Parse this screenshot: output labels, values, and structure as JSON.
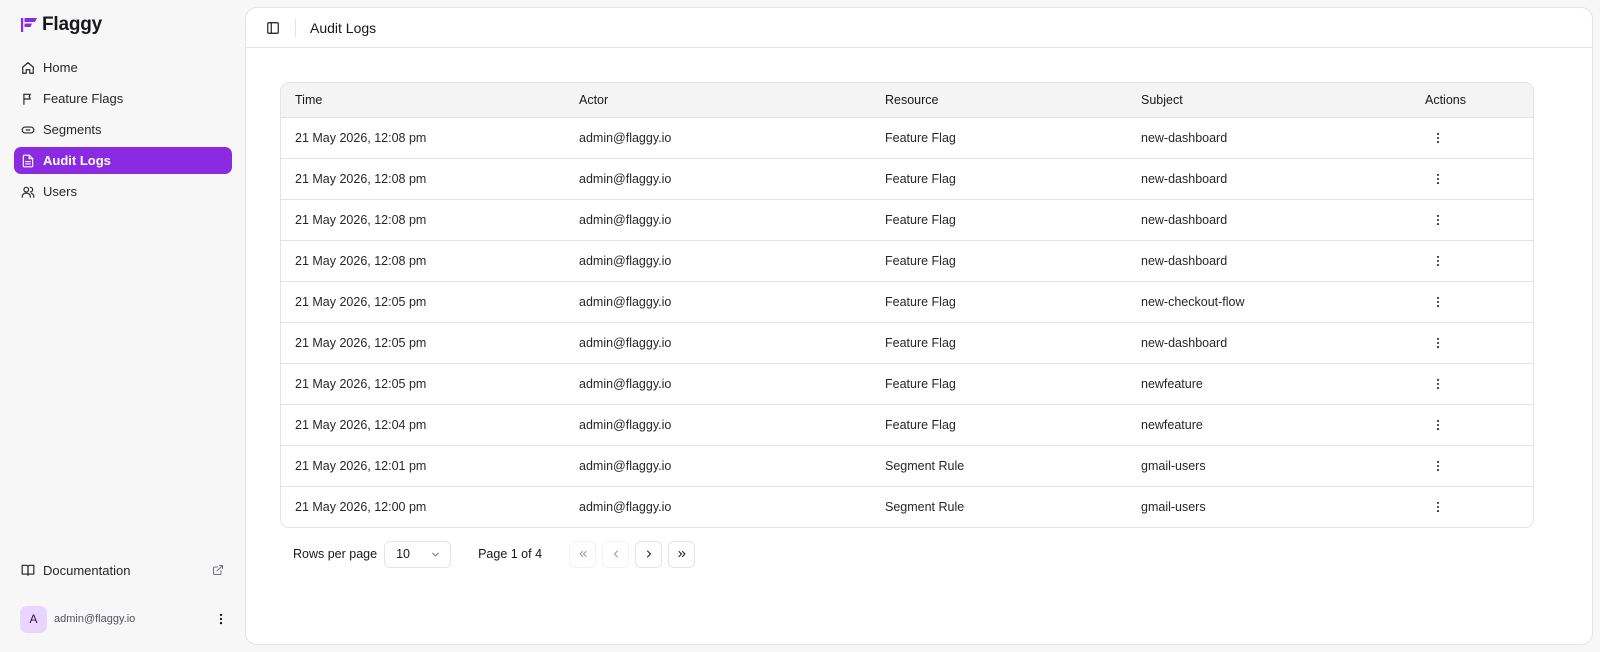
{
  "app": {
    "name": "Flaggy",
    "brand_color": "#8a2be2"
  },
  "sidebar": {
    "items": [
      {
        "label": "Home",
        "icon": "home-icon"
      },
      {
        "label": "Feature Flags",
        "icon": "flag-icon"
      },
      {
        "label": "Segments",
        "icon": "link-icon"
      },
      {
        "label": "Audit Logs",
        "icon": "file-text-icon",
        "active": true
      },
      {
        "label": "Users",
        "icon": "users-icon"
      }
    ],
    "documentation": {
      "label": "Documentation",
      "icon": "book-open-icon"
    },
    "user": {
      "initial": "A",
      "email": "admin@flaggy.io"
    }
  },
  "header": {
    "title": "Audit Logs"
  },
  "table": {
    "columns": [
      "Time",
      "Actor",
      "Resource",
      "Subject",
      "Actions"
    ],
    "rows": [
      [
        "21 May 2026, 12:08 pm",
        "admin@flaggy.io",
        "Feature Flag",
        "new-dashboard"
      ],
      [
        "21 May 2026, 12:08 pm",
        "admin@flaggy.io",
        "Feature Flag",
        "new-dashboard"
      ],
      [
        "21 May 2026, 12:08 pm",
        "admin@flaggy.io",
        "Feature Flag",
        "new-dashboard"
      ],
      [
        "21 May 2026, 12:08 pm",
        "admin@flaggy.io",
        "Feature Flag",
        "new-dashboard"
      ],
      [
        "21 May 2026, 12:05 pm",
        "admin@flaggy.io",
        "Feature Flag",
        "new-checkout-flow"
      ],
      [
        "21 May 2026, 12:05 pm",
        "admin@flaggy.io",
        "Feature Flag",
        "new-dashboard"
      ],
      [
        "21 May 2026, 12:05 pm",
        "admin@flaggy.io",
        "Feature Flag",
        "newfeature"
      ],
      [
        "21 May 2026, 12:04 pm",
        "admin@flaggy.io",
        "Feature Flag",
        "newfeature"
      ],
      [
        "21 May 2026, 12:01 pm",
        "admin@flaggy.io",
        "Segment Rule",
        "gmail-users"
      ],
      [
        "21 May 2026, 12:00 pm",
        "admin@flaggy.io",
        "Segment Rule",
        "gmail-users"
      ]
    ]
  },
  "pagination": {
    "rows_per_page_label": "Rows per page",
    "rows_per_page_value": "10",
    "page_info": "Page 1 of 4"
  }
}
